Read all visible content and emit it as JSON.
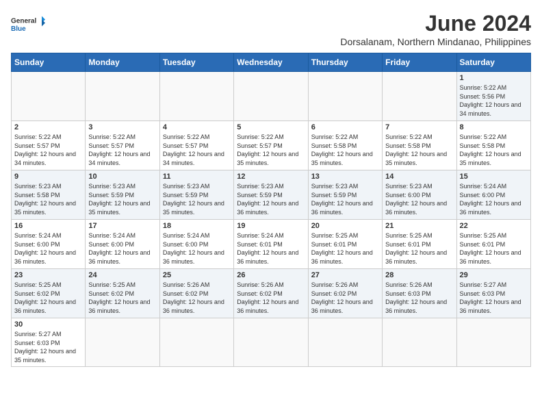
{
  "logo": {
    "text_general": "General",
    "text_blue": "Blue"
  },
  "title": "June 2024",
  "subtitle": "Dorsalanam, Northern Mindanao, Philippines",
  "headers": [
    "Sunday",
    "Monday",
    "Tuesday",
    "Wednesday",
    "Thursday",
    "Friday",
    "Saturday"
  ],
  "weeks": [
    [
      {
        "day": "",
        "info": ""
      },
      {
        "day": "",
        "info": ""
      },
      {
        "day": "",
        "info": ""
      },
      {
        "day": "",
        "info": ""
      },
      {
        "day": "",
        "info": ""
      },
      {
        "day": "",
        "info": ""
      },
      {
        "day": "1",
        "info": "Sunrise: 5:22 AM\nSunset: 5:56 PM\nDaylight: 12 hours and 34 minutes."
      }
    ],
    [
      {
        "day": "2",
        "info": "Sunrise: 5:22 AM\nSunset: 5:57 PM\nDaylight: 12 hours and 34 minutes."
      },
      {
        "day": "3",
        "info": "Sunrise: 5:22 AM\nSunset: 5:57 PM\nDaylight: 12 hours and 34 minutes."
      },
      {
        "day": "4",
        "info": "Sunrise: 5:22 AM\nSunset: 5:57 PM\nDaylight: 12 hours and 34 minutes."
      },
      {
        "day": "5",
        "info": "Sunrise: 5:22 AM\nSunset: 5:57 PM\nDaylight: 12 hours and 35 minutes."
      },
      {
        "day": "6",
        "info": "Sunrise: 5:22 AM\nSunset: 5:58 PM\nDaylight: 12 hours and 35 minutes."
      },
      {
        "day": "7",
        "info": "Sunrise: 5:22 AM\nSunset: 5:58 PM\nDaylight: 12 hours and 35 minutes."
      },
      {
        "day": "8",
        "info": "Sunrise: 5:22 AM\nSunset: 5:58 PM\nDaylight: 12 hours and 35 minutes."
      }
    ],
    [
      {
        "day": "9",
        "info": "Sunrise: 5:23 AM\nSunset: 5:58 PM\nDaylight: 12 hours and 35 minutes."
      },
      {
        "day": "10",
        "info": "Sunrise: 5:23 AM\nSunset: 5:59 PM\nDaylight: 12 hours and 35 minutes."
      },
      {
        "day": "11",
        "info": "Sunrise: 5:23 AM\nSunset: 5:59 PM\nDaylight: 12 hours and 35 minutes."
      },
      {
        "day": "12",
        "info": "Sunrise: 5:23 AM\nSunset: 5:59 PM\nDaylight: 12 hours and 36 minutes."
      },
      {
        "day": "13",
        "info": "Sunrise: 5:23 AM\nSunset: 5:59 PM\nDaylight: 12 hours and 36 minutes."
      },
      {
        "day": "14",
        "info": "Sunrise: 5:23 AM\nSunset: 6:00 PM\nDaylight: 12 hours and 36 minutes."
      },
      {
        "day": "15",
        "info": "Sunrise: 5:24 AM\nSunset: 6:00 PM\nDaylight: 12 hours and 36 minutes."
      }
    ],
    [
      {
        "day": "16",
        "info": "Sunrise: 5:24 AM\nSunset: 6:00 PM\nDaylight: 12 hours and 36 minutes."
      },
      {
        "day": "17",
        "info": "Sunrise: 5:24 AM\nSunset: 6:00 PM\nDaylight: 12 hours and 36 minutes."
      },
      {
        "day": "18",
        "info": "Sunrise: 5:24 AM\nSunset: 6:00 PM\nDaylight: 12 hours and 36 minutes."
      },
      {
        "day": "19",
        "info": "Sunrise: 5:24 AM\nSunset: 6:01 PM\nDaylight: 12 hours and 36 minutes."
      },
      {
        "day": "20",
        "info": "Sunrise: 5:25 AM\nSunset: 6:01 PM\nDaylight: 12 hours and 36 minutes."
      },
      {
        "day": "21",
        "info": "Sunrise: 5:25 AM\nSunset: 6:01 PM\nDaylight: 12 hours and 36 minutes."
      },
      {
        "day": "22",
        "info": "Sunrise: 5:25 AM\nSunset: 6:01 PM\nDaylight: 12 hours and 36 minutes."
      }
    ],
    [
      {
        "day": "23",
        "info": "Sunrise: 5:25 AM\nSunset: 6:02 PM\nDaylight: 12 hours and 36 minutes."
      },
      {
        "day": "24",
        "info": "Sunrise: 5:25 AM\nSunset: 6:02 PM\nDaylight: 12 hours and 36 minutes."
      },
      {
        "day": "25",
        "info": "Sunrise: 5:26 AM\nSunset: 6:02 PM\nDaylight: 12 hours and 36 minutes."
      },
      {
        "day": "26",
        "info": "Sunrise: 5:26 AM\nSunset: 6:02 PM\nDaylight: 12 hours and 36 minutes."
      },
      {
        "day": "27",
        "info": "Sunrise: 5:26 AM\nSunset: 6:02 PM\nDaylight: 12 hours and 36 minutes."
      },
      {
        "day": "28",
        "info": "Sunrise: 5:26 AM\nSunset: 6:03 PM\nDaylight: 12 hours and 36 minutes."
      },
      {
        "day": "29",
        "info": "Sunrise: 5:27 AM\nSunset: 6:03 PM\nDaylight: 12 hours and 36 minutes."
      }
    ],
    [
      {
        "day": "30",
        "info": "Sunrise: 5:27 AM\nSunset: 6:03 PM\nDaylight: 12 hours and 35 minutes."
      },
      {
        "day": "",
        "info": ""
      },
      {
        "day": "",
        "info": ""
      },
      {
        "day": "",
        "info": ""
      },
      {
        "day": "",
        "info": ""
      },
      {
        "day": "",
        "info": ""
      },
      {
        "day": "",
        "info": ""
      }
    ]
  ]
}
